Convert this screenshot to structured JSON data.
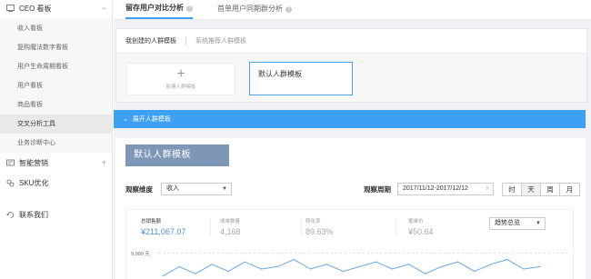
{
  "sidebar": {
    "groups": [
      {
        "label": "CEO 看板",
        "icon": "dashboard-icon",
        "toggle": "−"
      },
      {
        "label": "智能营销",
        "icon": "marketing-icon",
        "toggle": "+"
      },
      {
        "label": "SKU优化",
        "icon": "link-icon",
        "toggle": ""
      },
      {
        "label": "联系我们",
        "icon": "contact-icon",
        "toggle": ""
      }
    ],
    "items": [
      "收入看板",
      "复购魔法数字看板",
      "用户生命周期看板",
      "用户看板",
      "商品看板",
      "交叉分析工具",
      "业务诊断中心"
    ]
  },
  "tabs": [
    "留存用户对比分析",
    "首单用户同期群分析"
  ],
  "panel": {
    "tabs": [
      "我创建的人群模板",
      "系统推荐人群模板"
    ],
    "new_label": "新建人群模板",
    "template_label": "默认人群模板"
  },
  "expand_label": "展开人群模板",
  "content": {
    "template_title": "默认人群模板",
    "dimension_label": "观察维度",
    "dimension_value": "收入",
    "period_label": "观察周期",
    "period_value": "2017/11/12-2017/12/12",
    "granularity": [
      "时",
      "天",
      "周",
      "月"
    ],
    "trend_label": "趋势总览",
    "y_tick": "9,000 元"
  },
  "stats": [
    {
      "label": "总销售额",
      "value": "¥211,067.07"
    },
    {
      "label": "成单数量",
      "value": "4,168"
    },
    {
      "label": "转化率",
      "value": "89.63%"
    },
    {
      "label": "笔单价",
      "value": "¥50.64"
    }
  ],
  "colors": {
    "accent": "#3ea0f5",
    "template_head": "#7f97b6",
    "value": "#4a90d9"
  },
  "chart_data": {
    "type": "line",
    "series": [
      {
        "values": [
          2,
          6,
          3,
          7,
          4,
          8,
          5,
          6,
          9,
          5,
          7,
          4,
          6,
          8,
          5,
          7,
          3,
          6,
          8,
          4,
          7,
          9,
          5,
          6
        ]
      }
    ],
    "ylabel": "9,000 元"
  }
}
